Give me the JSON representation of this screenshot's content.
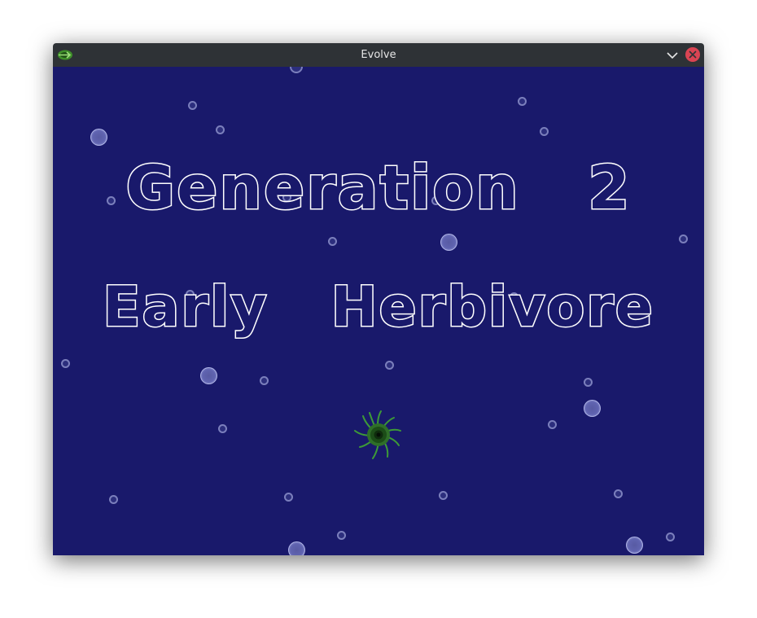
{
  "window": {
    "title": "Evolve",
    "icon": "green-fish-icon",
    "controls": [
      "minimize-chevron-icon",
      "close-icon"
    ],
    "close_color": "#da4453",
    "titlebar_color": "#2e3236"
  },
  "game": {
    "background_color": "#19196b",
    "generation_label": "Generation",
    "generation_number": "2",
    "stage_word_1": "Early",
    "stage_word_2": "Herbivore",
    "creature": "green-tentacled-microbe-icon",
    "bubble_color": "#9aa0d8"
  }
}
